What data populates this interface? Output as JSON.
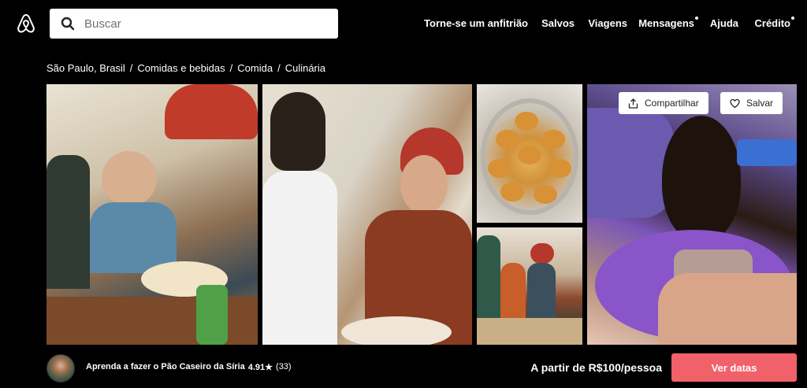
{
  "header": {
    "search": {
      "placeholder": "Buscar"
    },
    "nav": [
      {
        "label": "Torne-se um anfitrião",
        "dot": false
      },
      {
        "label": "Salvos",
        "dot": false
      },
      {
        "label": "Viagens",
        "dot": false
      },
      {
        "label": "Mensagens",
        "dot": true
      },
      {
        "label": "Ajuda",
        "dot": false
      },
      {
        "label": "Crédito",
        "dot": true
      }
    ]
  },
  "breadcrumb": [
    "São Paulo, Brasil",
    "Comidas e bebidas",
    "Comida",
    "Culinária"
  ],
  "gallery": {
    "share_label": "Compartilhar",
    "save_label": "Salvar"
  },
  "footer": {
    "experience_title": "Aprenda a fazer o Pão Caseiro da Síria",
    "rating": "4.91★",
    "reviews": "(33)",
    "price": "A partir de R$100/pessoa",
    "cta_label": "Ver datas"
  },
  "colors": {
    "brand": "#f0616a",
    "background": "#000000"
  },
  "icons": [
    "airbnb-logo-icon",
    "search-icon",
    "share-icon",
    "heart-icon"
  ]
}
